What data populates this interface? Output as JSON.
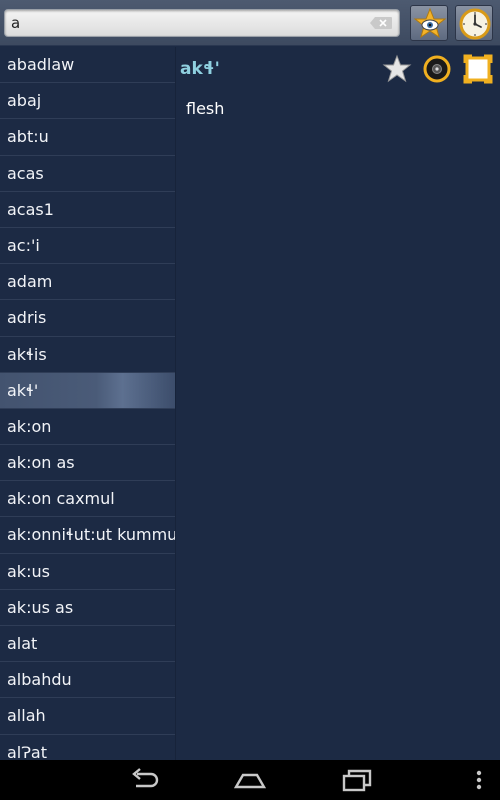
{
  "search": {
    "value": "a"
  },
  "wordlist": {
    "items": [
      "abadlaw",
      "abaj",
      "abt:u",
      "acas",
      "acas1",
      "ac:'i",
      "adam",
      "adris",
      "akɬis",
      "akɬ'",
      "ak:on",
      "ak:on as",
      "ak:on caxmul",
      "ak:onniɬut:ut kummul",
      "ak:us",
      "ak:us as",
      "alat",
      "albahdu",
      "allah",
      "alɁat"
    ],
    "selected_index": 9
  },
  "detail": {
    "title": "akɬ'",
    "definition": "flesh"
  },
  "icons": {
    "favorites": "star-eye-icon",
    "history": "clock-icon",
    "bookmark": "star-icon",
    "audio": "speaker-icon",
    "fullscreen": "fullscreen-icon",
    "back": "back-icon",
    "home": "home-icon",
    "recents": "recents-icon",
    "overflow": "overflow-menu-icon"
  },
  "colors": {
    "background": "#1c2a44",
    "title_accent": "#8fd0e0",
    "selected_row": "#4a5b78",
    "icon_gold": "#f0b020"
  }
}
